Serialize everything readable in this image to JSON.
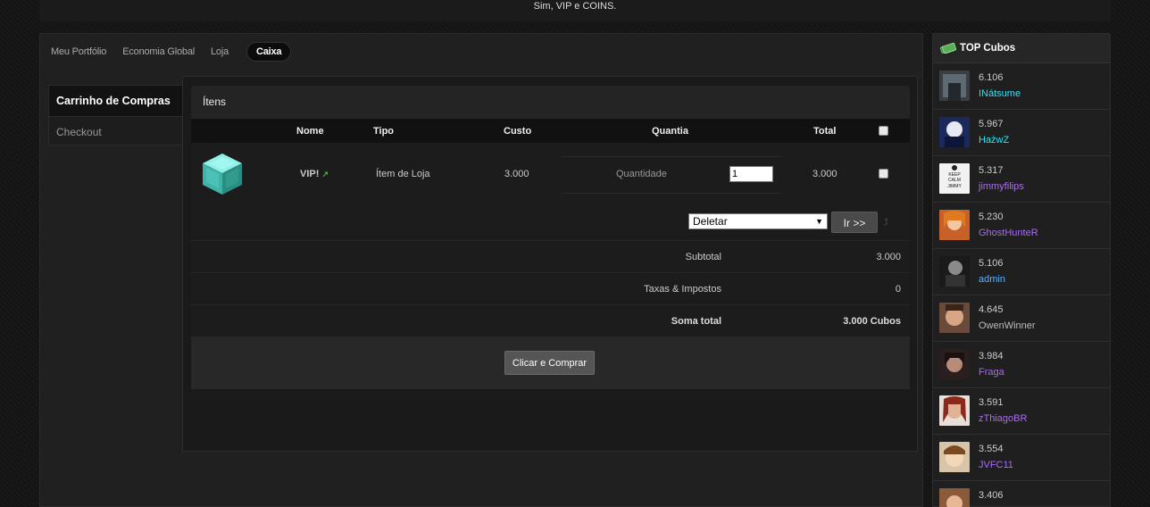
{
  "topbar": {
    "text": "Sim, VIP e COINS."
  },
  "tabs": [
    {
      "label": "Meu Portfólio",
      "active": false
    },
    {
      "label": "Economia Global",
      "active": false
    },
    {
      "label": "Loja",
      "active": false
    },
    {
      "label": "Caixa",
      "active": true
    }
  ],
  "leftnav": {
    "items": [
      {
        "label": "Carrinho de Compras"
      },
      {
        "label": "Checkout"
      }
    ]
  },
  "panel": {
    "title": "Ítens",
    "columns": {
      "name": "Nome",
      "type": "Tipo",
      "cost": "Custo",
      "qty": "Quantia",
      "total": "Total"
    },
    "item": {
      "name": "VIP!",
      "type": "Ítem de Loja",
      "cost": "3.000",
      "qty_label": "Quantidade",
      "qty_value": "1",
      "total": "3.000"
    },
    "action": {
      "selected": "Deletar",
      "go_label": "Ir >>"
    },
    "summary": [
      {
        "label": "Subtotal",
        "value": "3.000"
      },
      {
        "label": "Taxas & Impostos",
        "value": "0"
      },
      {
        "label": "Soma total",
        "value": "3.000 Cubos"
      }
    ],
    "buy_label": "Clicar e Comprar"
  },
  "sidebar": {
    "title": "TOP Cubos",
    "entries": [
      {
        "score": "6.106",
        "name": "INátsume",
        "color": "#33e0f0"
      },
      {
        "score": "5.967",
        "name": "HażwZ",
        "color": "#33e0f0"
      },
      {
        "score": "5.317",
        "name": "jimmyfilips",
        "color": "#a86cf0"
      },
      {
        "score": "5.230",
        "name": "GhostHunteR",
        "color": "#a86cf0"
      },
      {
        "score": "5.106",
        "name": "admin",
        "color": "#5bb0ff"
      },
      {
        "score": "4.645",
        "name": "OwenWinner",
        "color": "#bbbbbb"
      },
      {
        "score": "3.984",
        "name": "Fraga",
        "color": "#a86cf0"
      },
      {
        "score": "3.591",
        "name": "zThiagoBR",
        "color": "#a86cf0"
      },
      {
        "score": "3.554",
        "name": "JVFC11",
        "color": "#a86cf0"
      },
      {
        "score": "3.406",
        "name": "",
        "color": "#bbbbbb"
      }
    ],
    "avatar_text": "KEEP CALM JIMMY"
  }
}
